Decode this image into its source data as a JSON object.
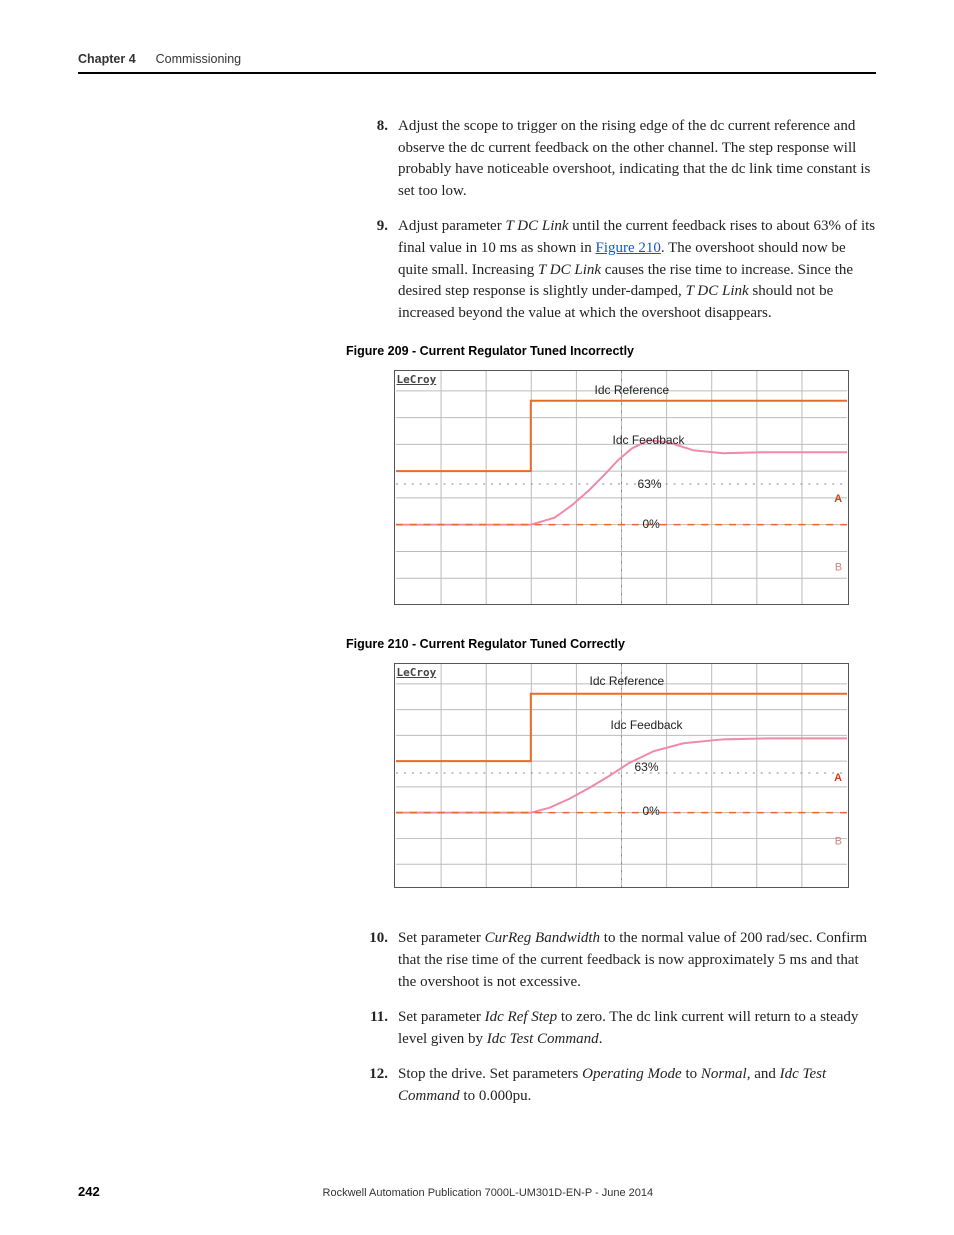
{
  "header": {
    "chapter": "Chapter 4",
    "title": "Commissioning"
  },
  "steps_a": [
    {
      "num": "8.",
      "text": "Adjust the scope to trigger on the rising edge of the dc current reference and observe the dc current feedback on the other channel. The step response will probably have noticeable overshoot, indicating that the dc link time constant is set too low."
    },
    {
      "num": "9.",
      "pre": "Adjust parameter ",
      "ital1": "T DC Link",
      "mid1": " until the current feedback rises to about 63% of its final value in 10 ms as shown in ",
      "link": "Figure 210",
      "mid2": ". The overshoot should now be quite small. Increasing ",
      "ital2": "T DC Link",
      "mid3": " causes the rise time to increase. Since the desired step response is slightly under-damped, ",
      "ital3": "T DC Link",
      "end": " should not be increased beyond the value at which the overshoot disappears."
    }
  ],
  "fig209_caption": "Figure 209 - Current Regulator Tuned Incorrectly",
  "fig210_caption": "Figure 210 - Current Regulator Tuned Correctly",
  "scope": {
    "brand": "LeCroy",
    "ref": "Idc Reference",
    "fb": "Idc Feedback",
    "p63": "63%",
    "p0": "0%",
    "a": "A",
    "b": "B"
  },
  "steps_b": [
    {
      "num": "10.",
      "pre": "Set parameter ",
      "ital1": "CurReg Bandwidth",
      "end": " to the normal value of 200 rad/sec. Confirm that the rise time of the current feedback is now approximately 5 ms and that the overshoot is not excessive."
    },
    {
      "num": "11.",
      "pre": "Set parameter ",
      "ital1": "Idc Ref Step",
      "mid1": " to zero. The dc link current will return to a steady level given by ",
      "ital2": "Idc Test Command",
      "end": "."
    },
    {
      "num": "12.",
      "pre": "Stop the drive. Set parameters ",
      "ital1": "Operating Mode",
      "mid1": " to ",
      "ital2": "Normal",
      "mid2": ", and ",
      "ital3": "Idc Test Command",
      "end": " to 0.000pu."
    }
  ],
  "footer": {
    "page": "242",
    "pub": "Rockwell Automation Publication 7000L-UM301D-EN-P - June 2014"
  }
}
